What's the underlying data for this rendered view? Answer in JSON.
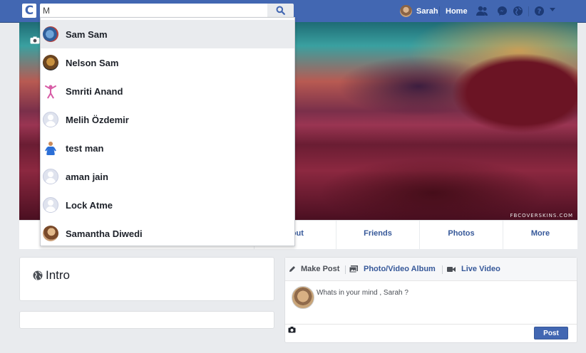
{
  "header": {
    "logo_letter": "C",
    "search": {
      "value": "M",
      "placeholder": ""
    },
    "user_name": "Sarah",
    "home_label": "Home",
    "accent": "#4267b2"
  },
  "search_results": [
    {
      "name": "Sam Sam",
      "avatar": "photo-globe"
    },
    {
      "name": "Nelson Sam",
      "avatar": "photo-dog"
    },
    {
      "name": "Smriti Anand",
      "avatar": "photo-dancer"
    },
    {
      "name": "Melih Özdemir",
      "avatar": "default-silhouette"
    },
    {
      "name": "test man",
      "avatar": "photo-man-blue"
    },
    {
      "name": "aman jain",
      "avatar": "default-silhouette"
    },
    {
      "name": "Lock Atme",
      "avatar": "default-silhouette"
    },
    {
      "name": "Samantha Diwedi",
      "avatar": "photo-woman"
    }
  ],
  "cover": {
    "watermark": "FBCOVERSKINS.COM"
  },
  "profile_tabs": [
    "bout",
    "Friends",
    "Photos",
    "More"
  ],
  "intro": {
    "title": "Intro"
  },
  "composer": {
    "tabs": {
      "make_post": "Make Post",
      "photo_album": "Photo/Video Album",
      "live_video": "Live Video"
    },
    "placeholder": "Whats in your mind , Sarah ?",
    "post_label": "Post"
  }
}
